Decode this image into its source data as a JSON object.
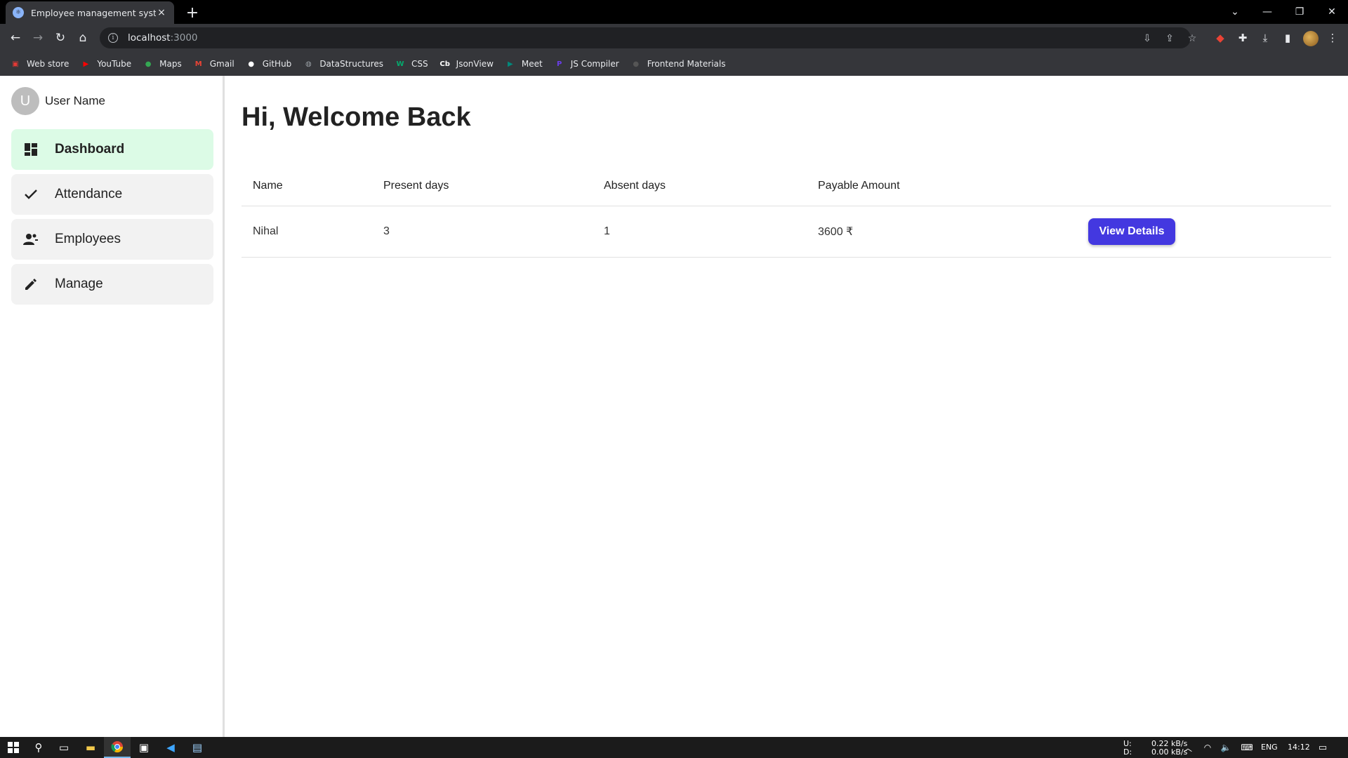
{
  "browser": {
    "tab_title": "Employee management system",
    "tab_close": "×",
    "new_tab": "+",
    "url_host": "localhost",
    "url_port": ":3000"
  },
  "bookmarks": [
    {
      "label": "Web store",
      "icon": "store-icon",
      "color": "#e53935"
    },
    {
      "label": "YouTube",
      "icon": "youtube-icon",
      "color": "#ff0000"
    },
    {
      "label": "Maps",
      "icon": "maps-icon",
      "color": "#34a853"
    },
    {
      "label": "Gmail",
      "icon": "gmail-icon",
      "color": "#ea4335"
    },
    {
      "label": "GitHub",
      "icon": "github-icon",
      "color": "#ffffff"
    },
    {
      "label": "DataStructures",
      "icon": "globe-icon",
      "color": "#9aa0a6"
    },
    {
      "label": "CSS",
      "icon": "w3-icon",
      "color": "#04aa6d"
    },
    {
      "label": "JsonView",
      "icon": "cb-icon",
      "color": "#ffffff"
    },
    {
      "label": "Meet",
      "icon": "meet-icon",
      "color": "#00897b"
    },
    {
      "label": "JS Compiler",
      "icon": "programiz-icon",
      "color": "#6a3de8"
    },
    {
      "label": "Frontend Materials",
      "icon": "github-icon",
      "color": "#555555"
    }
  ],
  "sidebar": {
    "avatar_letter": "U",
    "user_name": "User Name",
    "items": [
      {
        "label": "Dashboard",
        "icon": "dashboard-icon",
        "active": true
      },
      {
        "label": "Attendance",
        "icon": "check-icon",
        "active": false
      },
      {
        "label": "Employees",
        "icon": "people-icon",
        "active": false
      },
      {
        "label": "Manage",
        "icon": "pencil-icon",
        "active": false
      }
    ]
  },
  "main": {
    "heading": "Hi, Welcome Back",
    "columns": [
      "Name",
      "Present days",
      "Absent days",
      "Payable Amount"
    ],
    "rows": [
      {
        "name": "Nihal",
        "present": "3",
        "absent": "1",
        "amount": "3600 ₹",
        "action": "View Details"
      }
    ]
  },
  "taskbar": {
    "net_up_label": "U:",
    "net_down_label": "D:",
    "net_up": "0.22 kB/s",
    "net_down": "0.00 kB/s",
    "lang": "ENG",
    "time": "14:12"
  },
  "colors": {
    "accent": "#4338e0",
    "active_nav": "#dcfbe6"
  }
}
